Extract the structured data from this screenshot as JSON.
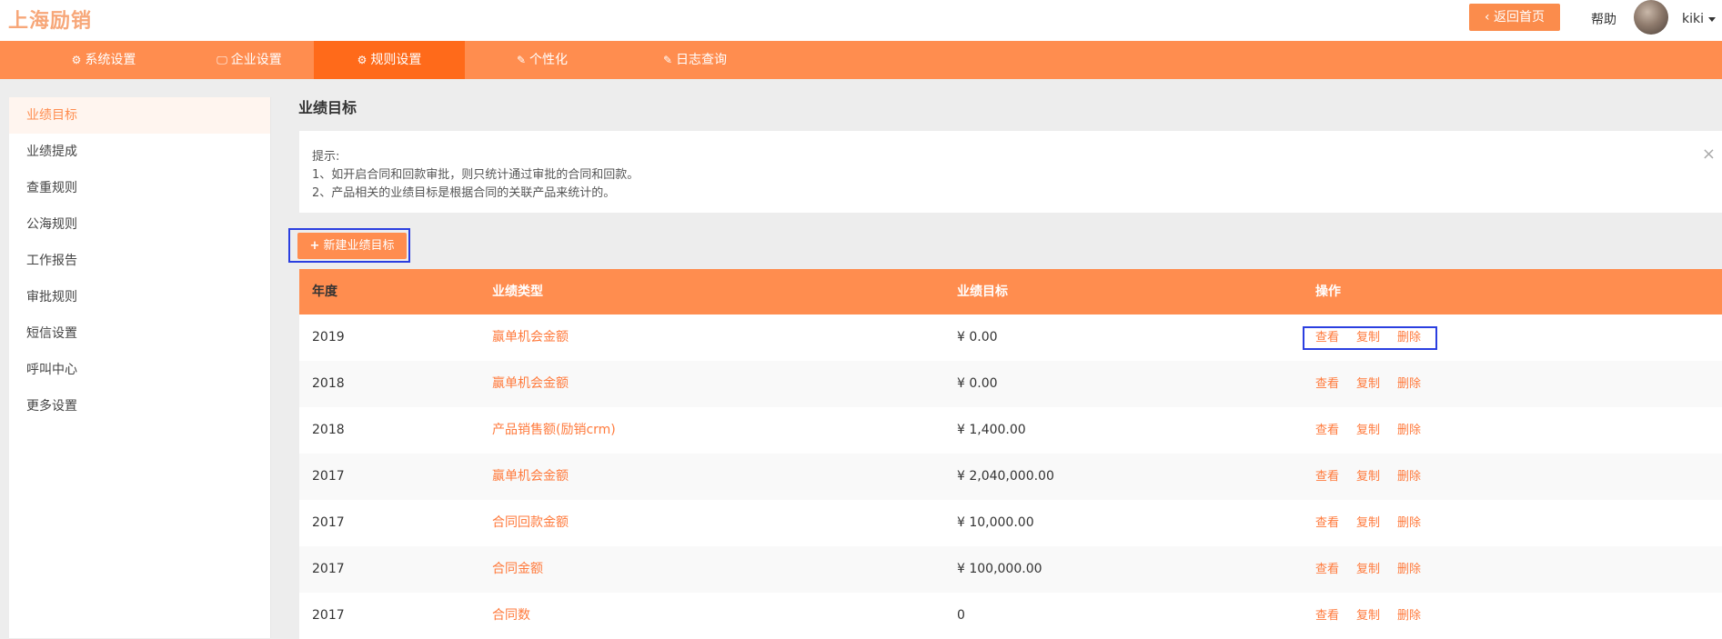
{
  "header": {
    "logo": "上海励销",
    "back_label": "‹ 返回首页",
    "help": "帮助",
    "user": "kiki"
  },
  "nav": {
    "items": [
      {
        "label": "系统设置",
        "icon": "⚙"
      },
      {
        "label": "企业设置",
        "icon": "🖵"
      },
      {
        "label": "规则设置",
        "icon": "⚙"
      },
      {
        "label": "个性化",
        "icon": "✎"
      },
      {
        "label": "日志查询",
        "icon": "✎"
      }
    ]
  },
  "sidebar": {
    "items": [
      "业绩目标",
      "业绩提成",
      "查重规则",
      "公海规则",
      "工作报告",
      "审批规则",
      "短信设置",
      "呼叫中心",
      "更多设置"
    ]
  },
  "main": {
    "title": "业绩目标",
    "tip": {
      "heading": "提示:",
      "line1": "1、如开启合同和回款审批，则只统计通过审批的合同和回款。",
      "line2": "2、产品相关的业绩目标是根据合同的关联产品来统计的。",
      "close": "×"
    },
    "new_button": "新建业绩目标",
    "table": {
      "headers": [
        "年度",
        "业绩类型",
        "业绩目标",
        "操作"
      ],
      "rows": [
        {
          "year": "2019",
          "type": "赢单机会金额",
          "target": "¥ 0.00"
        },
        {
          "year": "2018",
          "type": "赢单机会金额",
          "target": "¥ 0.00"
        },
        {
          "year": "2018",
          "type": "产品销售额(励销crm)",
          "target": "¥ 1,400.00"
        },
        {
          "year": "2017",
          "type": "赢单机会金额",
          "target": "¥ 2,040,000.00"
        },
        {
          "year": "2017",
          "type": "合同回款金额",
          "target": "¥ 10,000.00"
        },
        {
          "year": "2017",
          "type": "合同金额",
          "target": "¥ 100,000.00"
        },
        {
          "year": "2017",
          "type": "合同数",
          "target": "0"
        }
      ],
      "ops": [
        "查看",
        "复制",
        "删除"
      ]
    }
  },
  "colors": {
    "accent": "#ff8d4f",
    "accent_active": "#ff6a1a",
    "highlight_box": "#2b3fe0"
  }
}
